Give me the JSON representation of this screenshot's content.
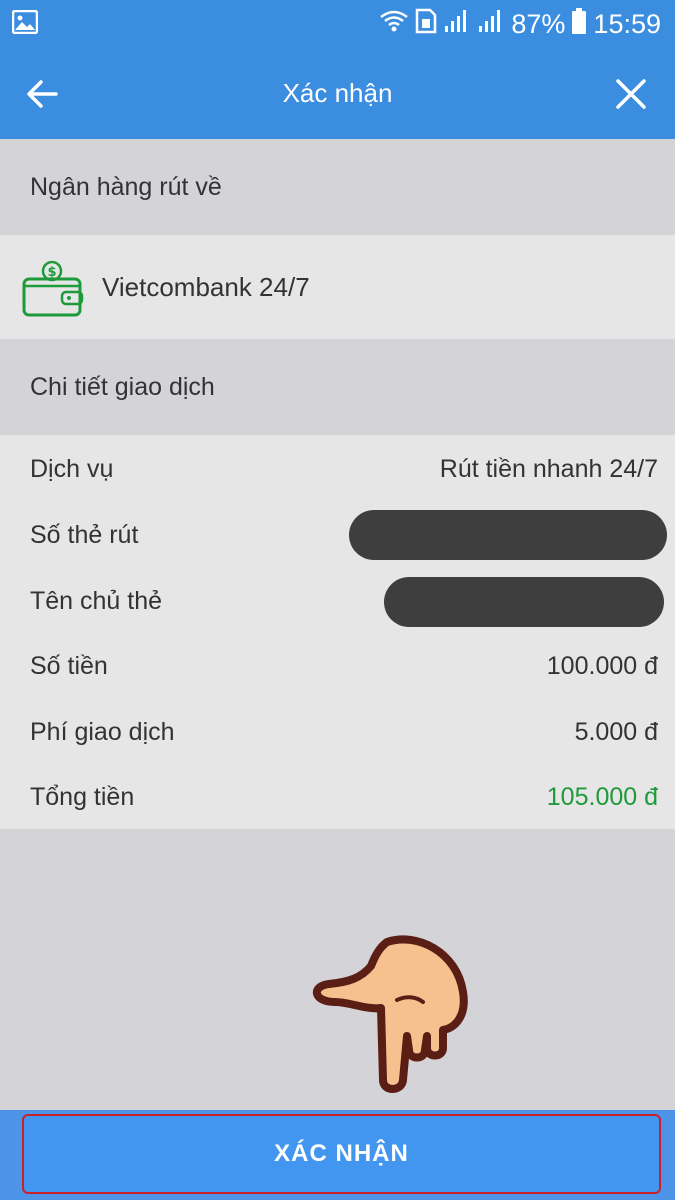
{
  "status_bar": {
    "battery": "87%",
    "time": "15:59",
    "icons": [
      "gallery-icon",
      "wifi-icon",
      "sim-icon",
      "signal-icon",
      "signal-icon",
      "battery-icon"
    ]
  },
  "app_bar": {
    "title": "Xác nhận",
    "back_icon": "arrow-left-icon",
    "close_icon": "close-icon"
  },
  "bank_section": {
    "header": "Ngân hàng rút về",
    "bank_name": "Vietcombank 24/7",
    "icon": "wallet-icon",
    "icon_color": "#1f9a3a"
  },
  "detail_section": {
    "header": "Chi tiết giao dịch",
    "rows": [
      {
        "label": "Dịch vụ",
        "value": "Rút tiền nhanh 24/7"
      },
      {
        "label": "Số thẻ rút",
        "value": ""
      },
      {
        "label": "Tên chủ thẻ",
        "value": ""
      },
      {
        "label": "Số tiền",
        "value": "100.000 đ"
      },
      {
        "label": "Phí giao dịch",
        "value": "5.000 đ"
      },
      {
        "label": "Tổng tiền",
        "value": "105.000 đ"
      }
    ],
    "total_color": "#1f9a3a"
  },
  "footer": {
    "confirm_label": "XÁC NHẬN",
    "accent": "#4296f0",
    "highlight_border": "#c9202a"
  },
  "overlay": {
    "icon": "pointing-hand-icon"
  }
}
